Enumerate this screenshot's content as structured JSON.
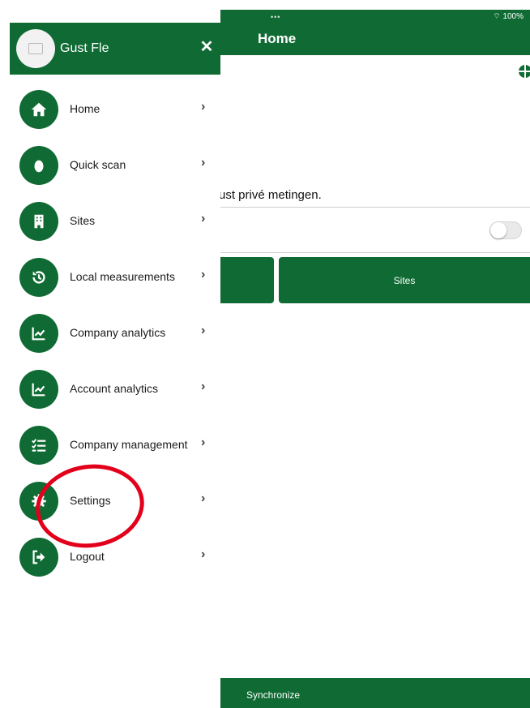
{
  "status": {
    "dots": "•••",
    "battery": "100%"
  },
  "header": {
    "title": "Home"
  },
  "content": {
    "private_text": "ust privé metingen.",
    "toggle_on": false,
    "sites_button": "Sites"
  },
  "footer": {
    "sync_label": "Synchronize"
  },
  "drawer": {
    "user_name": "Gust Fle",
    "close": "✕",
    "items": [
      {
        "label": "Home",
        "icon": "home-icon"
      },
      {
        "label": "Quick scan",
        "icon": "drop-icon"
      },
      {
        "label": "Sites",
        "icon": "building-icon"
      },
      {
        "label": "Local measurements",
        "icon": "history-icon"
      },
      {
        "label": "Company analytics",
        "icon": "chart-icon"
      },
      {
        "label": "Account analytics",
        "icon": "chart-icon"
      },
      {
        "label": "Company management",
        "icon": "checklist-icon"
      },
      {
        "label": "Settings",
        "icon": "gear-icon"
      },
      {
        "label": "Logout",
        "icon": "logout-icon"
      }
    ],
    "chevron": "›"
  },
  "colors": {
    "brand": "#0f6b33",
    "annotation": "#e3001b"
  }
}
